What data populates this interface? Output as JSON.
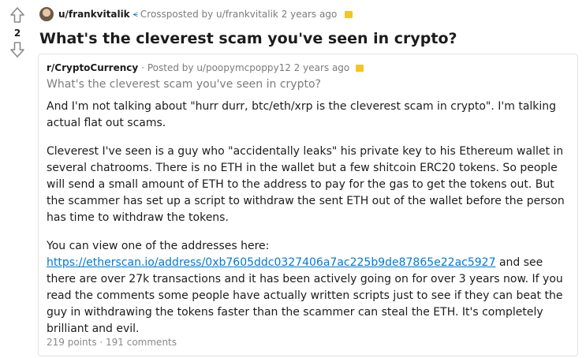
{
  "post": {
    "score": "2",
    "author": "u/frankvitalik",
    "crosspost_text": "Crossposted by u/frankvitalik 2 years ago",
    "title": "What's the cleverest scam you've seen in crypto?"
  },
  "crosspost": {
    "subreddit": "r/CryptoCurrency",
    "meta_text": "· Posted by u/poopymcpoppy12 2 years ago",
    "title": "What's the cleverest scam you've seen in crypto?",
    "paragraphs": {
      "p1": "And I'm not talking about \"hurr durr, btc/eth/xrp is the cleverest scam in crypto\". I'm talking actual flat out scams.",
      "p2": "Cleverest I've seen is a guy who \"accidentally leaks\" his private key to his Ethereum wallet in several chatrooms. There is no ETH in the wallet but a few shitcoin ERC20 tokens. So people will send a small amount of ETH to the address to pay for the gas to get the tokens out. But the scammer has set up a script to withdraw the sent ETH out of the wallet before the person has time to withdraw the tokens.",
      "p3_before": "You can view one of the addresses here: ",
      "p3_link": "https://etherscan.io/address/0xb7605ddc0327406a7ac225b9de87865e22ac5927",
      "p3_after": " and see there are over 27k transactions and it has been actively going on for over 3 years now. If you read the comments some people have actually written scripts just to see if they can beat the guy in withdrawing the tokens faster than the scammer can steal the ETH. It's completely brilliant and evil."
    },
    "footer": "219 points · 191 comments"
  },
  "icons": {
    "upvote": "arrow-up-outline",
    "downvote": "arrow-down-outline",
    "crosspost": "crosspost-arrow",
    "award": "award-badge"
  },
  "colors": {
    "link": "#0079d3",
    "award": "#f3c623",
    "muted": "#7c7c7c"
  }
}
